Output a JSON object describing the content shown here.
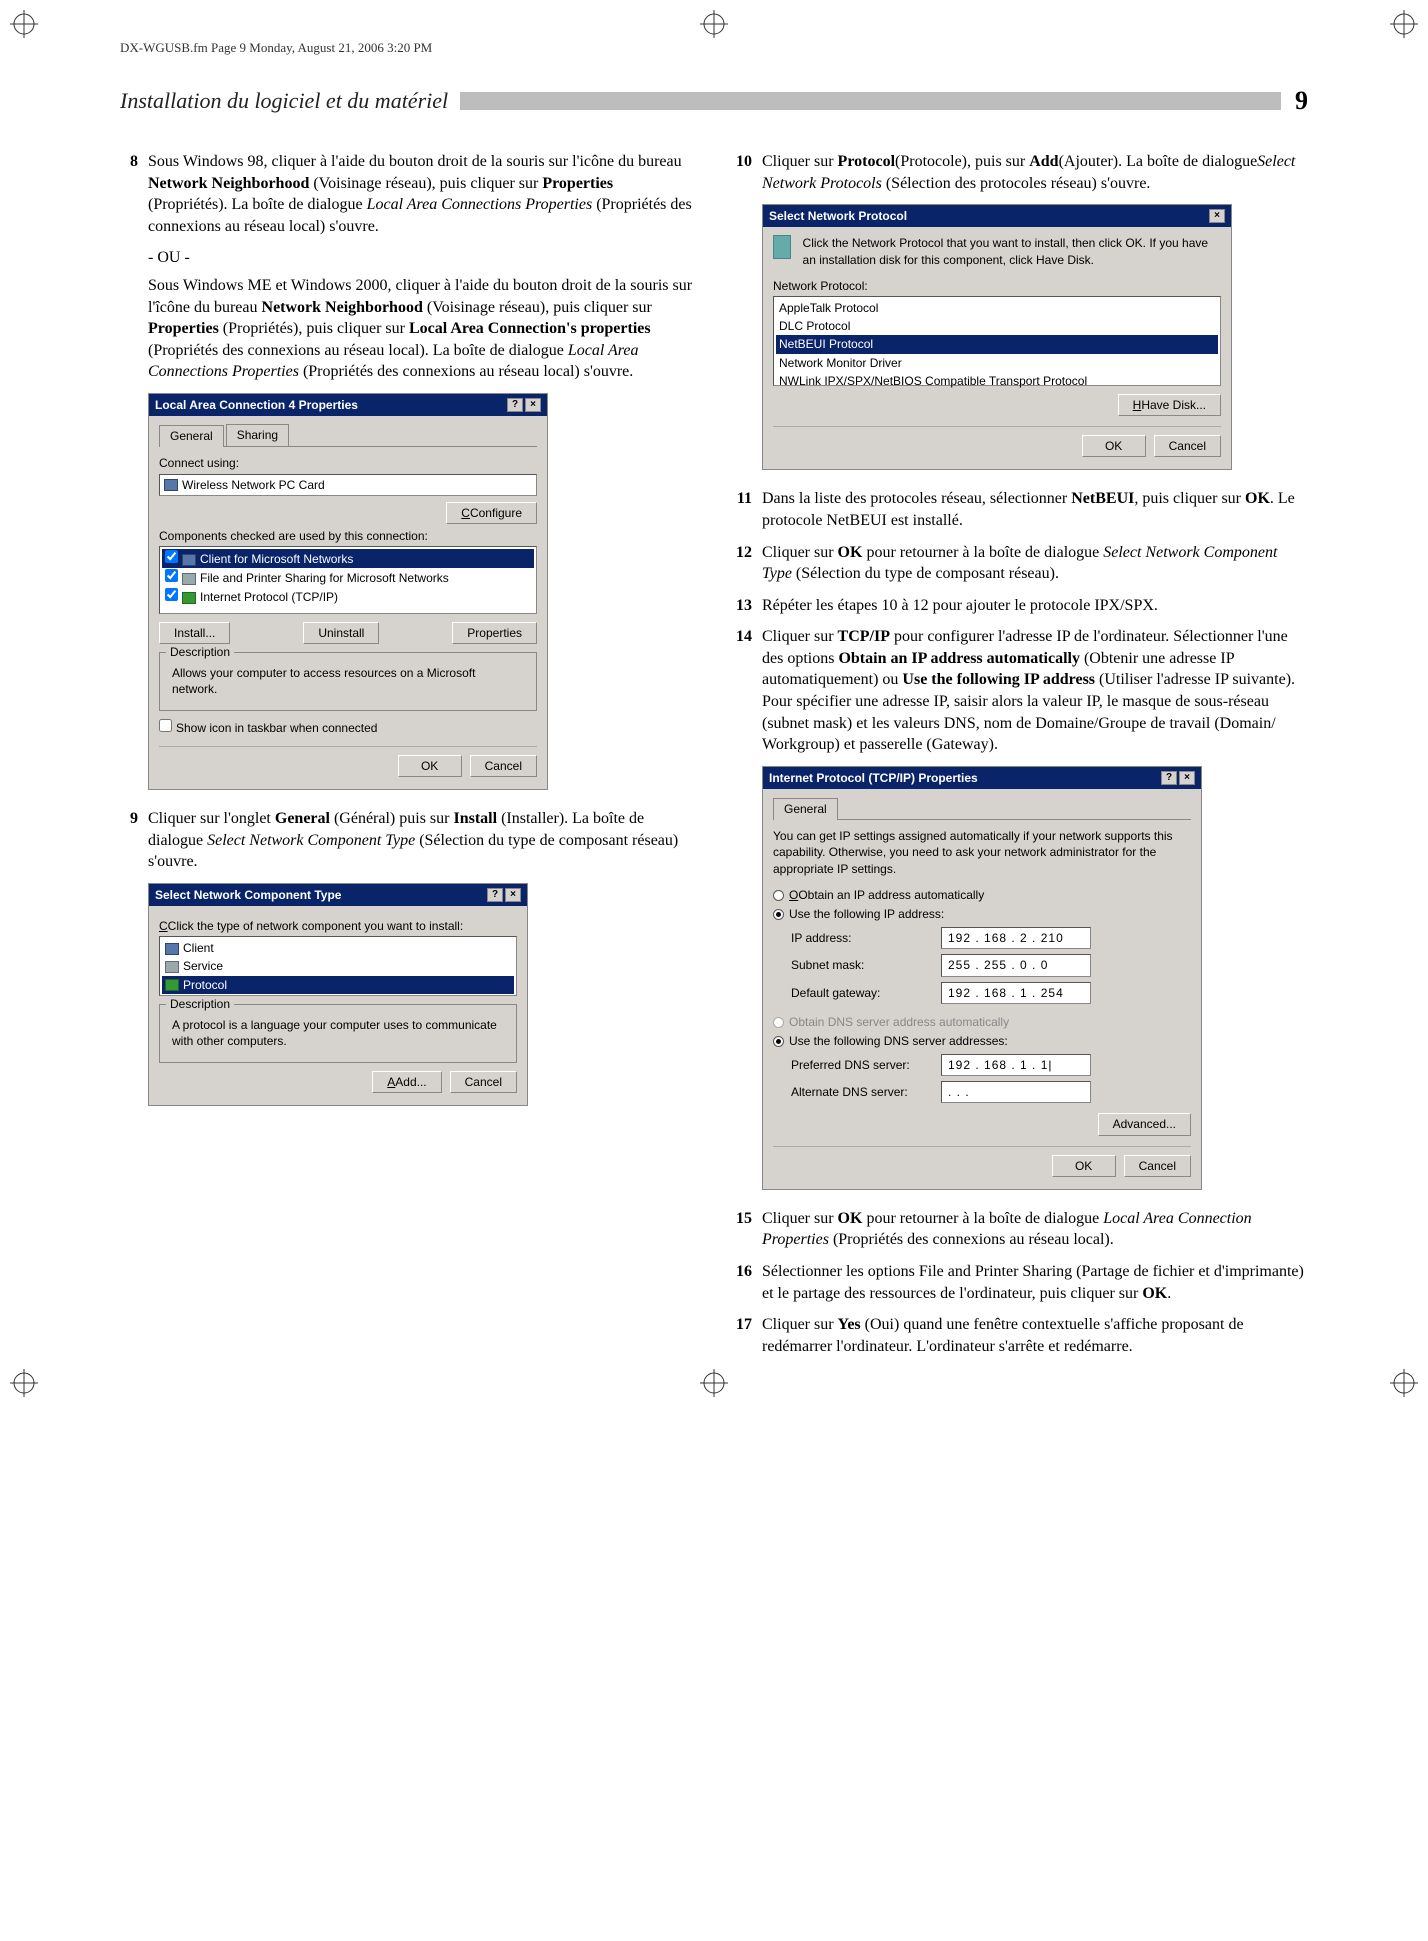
{
  "page_meta": "DX-WGUSB.fm  Page 9  Monday, August 21, 2006  3:20 PM",
  "header": {
    "title": "Installation du logiciel et du matériel",
    "page_number": "9"
  },
  "steps": {
    "s8a": "Sous Windows 98, cliquer à l'aide du bouton droit de la souris sur l'icône du bureau ",
    "s8b": "Network Neighborhood",
    "s8c": " (Voisinage réseau), puis cliquer sur ",
    "s8d": "Properties",
    "s8e": " (Propriétés). La boîte de dialogue ",
    "s8f": "Local Area Connections Properties",
    "s8g": " (Propriétés des connexions au réseau local) s'ouvre.",
    "or": "- OU -",
    "s8h": "Sous Windows ME et Windows 2000, cliquer à l'aide du bouton droit de la souris sur l'îcône du bureau ",
    "s8i": "Network Neighborhood",
    "s8j": " (Voisinage réseau), puis cliquer sur ",
    "s8k": "Properties",
    "s8l": " (Propriétés), puis cliquer sur ",
    "s8m": "Local Area Connection's properties",
    "s8n": " (Propriétés des connexions au réseau local). La boîte de dialogue ",
    "s8o": "Local Area Connections Properties",
    "s8p": " (Propriétés des connexions au réseau local) s'ouvre.",
    "s9a": "Cliquer sur l'onglet ",
    "s9b": "General",
    "s9c": " (Général) puis sur ",
    "s9d": "Install",
    "s9e": " (Installer). La boîte de dialogue ",
    "s9f": "Select Network Component Type",
    "s9g": " (Sélection du type de composant réseau) s'ouvre.",
    "s10a": "Cliquer sur ",
    "s10b": "Protocol",
    "s10c": "(Protocole), puis sur ",
    "s10d": "Add",
    "s10e": "(Ajouter). La boîte de dialogue",
    "s10f": "Select Network Protocols",
    "s10g": " (Sélection des protocoles réseau) s'ouvre.",
    "s11a": "Dans la liste des protocoles réseau, sélectionner ",
    "s11b": "NetBEUI",
    "s11c": ", puis cliquer sur ",
    "s11d": "OK",
    "s11e": ". Le protocole NetBEUI est installé.",
    "s12a": "Cliquer sur ",
    "s12b": "OK",
    "s12c": " pour retourner à la boîte de dialogue ",
    "s12d": "Select Network Component Type",
    "s12e": " (Sélection du type de composant réseau).",
    "s13": "Répéter les étapes 10 à 12 pour ajouter le protocole IPX/SPX.",
    "s14a": "Cliquer sur ",
    "s14b": "TCP/IP",
    "s14c": " pour configurer l'adresse IP de l'ordinateur. Sélectionner l'une des options ",
    "s14d": "Obtain an IP address automatically",
    "s14e": " (Obtenir une adresse IP automatiquement) ou ",
    "s14f": "Use the following IP address",
    "s14g": " (Utiliser l'adresse IP suivante). Pour spécifier une adresse IP, saisir alors la valeur IP, le masque de sous-réseau (subnet mask) et les valeurs DNS, nom de Domaine/Groupe de travail (Domain/ Workgroup) et passerelle (Gateway).",
    "s15a": "Cliquer sur ",
    "s15b": "OK",
    "s15c": " pour retourner à la boîte de dialogue ",
    "s15d": "Local Area Connection Properties",
    "s15e": " (Propriétés des connexions au réseau local).",
    "s16a": "Sélectionner les options File and Printer Sharing (Partage de fichier et d'imprimante) et le partage des ressources de l'ordinateur, puis cliquer sur ",
    "s16b": "OK",
    "s16c": ".",
    "s17a": "Cliquer sur ",
    "s17b": "Yes",
    "s17c": " (Oui) quand une fenêtre contextuelle s'affiche proposant de redémarrer l'ordinateur. L'ordinateur s'arrête et redémarre."
  },
  "dlg_lac": {
    "title": "Local Area Connection 4 Properties",
    "tab_general": "General",
    "tab_sharing": "Sharing",
    "connect_using": "Connect using:",
    "adapter": "Wireless Network PC Card",
    "configure": "Configure",
    "components_label": "Components checked are used by this connection:",
    "comp1": "Client for Microsoft Networks",
    "comp2": "File and Printer Sharing for Microsoft Networks",
    "comp3": "Internet Protocol (TCP/IP)",
    "install": "Install...",
    "uninstall": "Uninstall",
    "properties": "Properties",
    "desc_label": "Description",
    "desc_text": "Allows your computer to access resources on a Microsoft network.",
    "show_icon": "Show icon in taskbar when connected",
    "ok": "OK",
    "cancel": "Cancel"
  },
  "dlg_snct": {
    "title": "Select Network Component Type",
    "instruct": "Click the type of network component you want to install:",
    "client": "Client",
    "service": "Service",
    "protocol": "Protocol",
    "desc_label": "Description",
    "desc_text": "A protocol is a language your computer uses to communicate with other computers.",
    "add": "Add...",
    "cancel": "Cancel"
  },
  "dlg_snp": {
    "title": "Select Network Protocol",
    "instruct": "Click the Network Protocol that you want to install, then click OK. If you have an installation disk for this component, click Have Disk.",
    "list_label": "Network Protocol:",
    "items": [
      "AppleTalk Protocol",
      "DLC Protocol",
      "NetBEUI Protocol",
      "Network Monitor Driver",
      "NWLink IPX/SPX/NetBIOS Compatible Transport Protocol"
    ],
    "have_disk": "Have Disk...",
    "ok": "OK",
    "cancel": "Cancel"
  },
  "dlg_tcp": {
    "title": "Internet Protocol (TCP/IP) Properties",
    "tab_general": "General",
    "intro": "You can get IP settings assigned automatically if your network supports this capability. Otherwise, you need to ask your network administrator for the appropriate IP settings.",
    "obtain_auto": "Obtain an IP address automatically",
    "use_following": "Use the following IP address:",
    "ip_label": "IP address:",
    "ip_value": "192 . 168 .   2  . 210",
    "subnet_label": "Subnet mask:",
    "subnet_value": "255 . 255 .   0  .   0",
    "gateway_label": "Default gateway:",
    "gateway_value": "192 . 168 .   1  . 254",
    "obtain_dns_auto": "Obtain DNS server address automatically",
    "use_dns": "Use the following DNS server addresses:",
    "pref_dns_label": "Preferred DNS server:",
    "pref_dns_value": "192 . 168 .   1  .   1|",
    "alt_dns_label": "Alternate DNS server:",
    "alt_dns_value": " .       .       . ",
    "advanced": "Advanced...",
    "ok": "OK",
    "cancel": "Cancel"
  },
  "nums": {
    "n8": "8",
    "n9": "9",
    "n10": "10",
    "n11": "11",
    "n12": "12",
    "n13": "13",
    "n14": "14",
    "n15": "15",
    "n16": "16",
    "n17": "17"
  }
}
